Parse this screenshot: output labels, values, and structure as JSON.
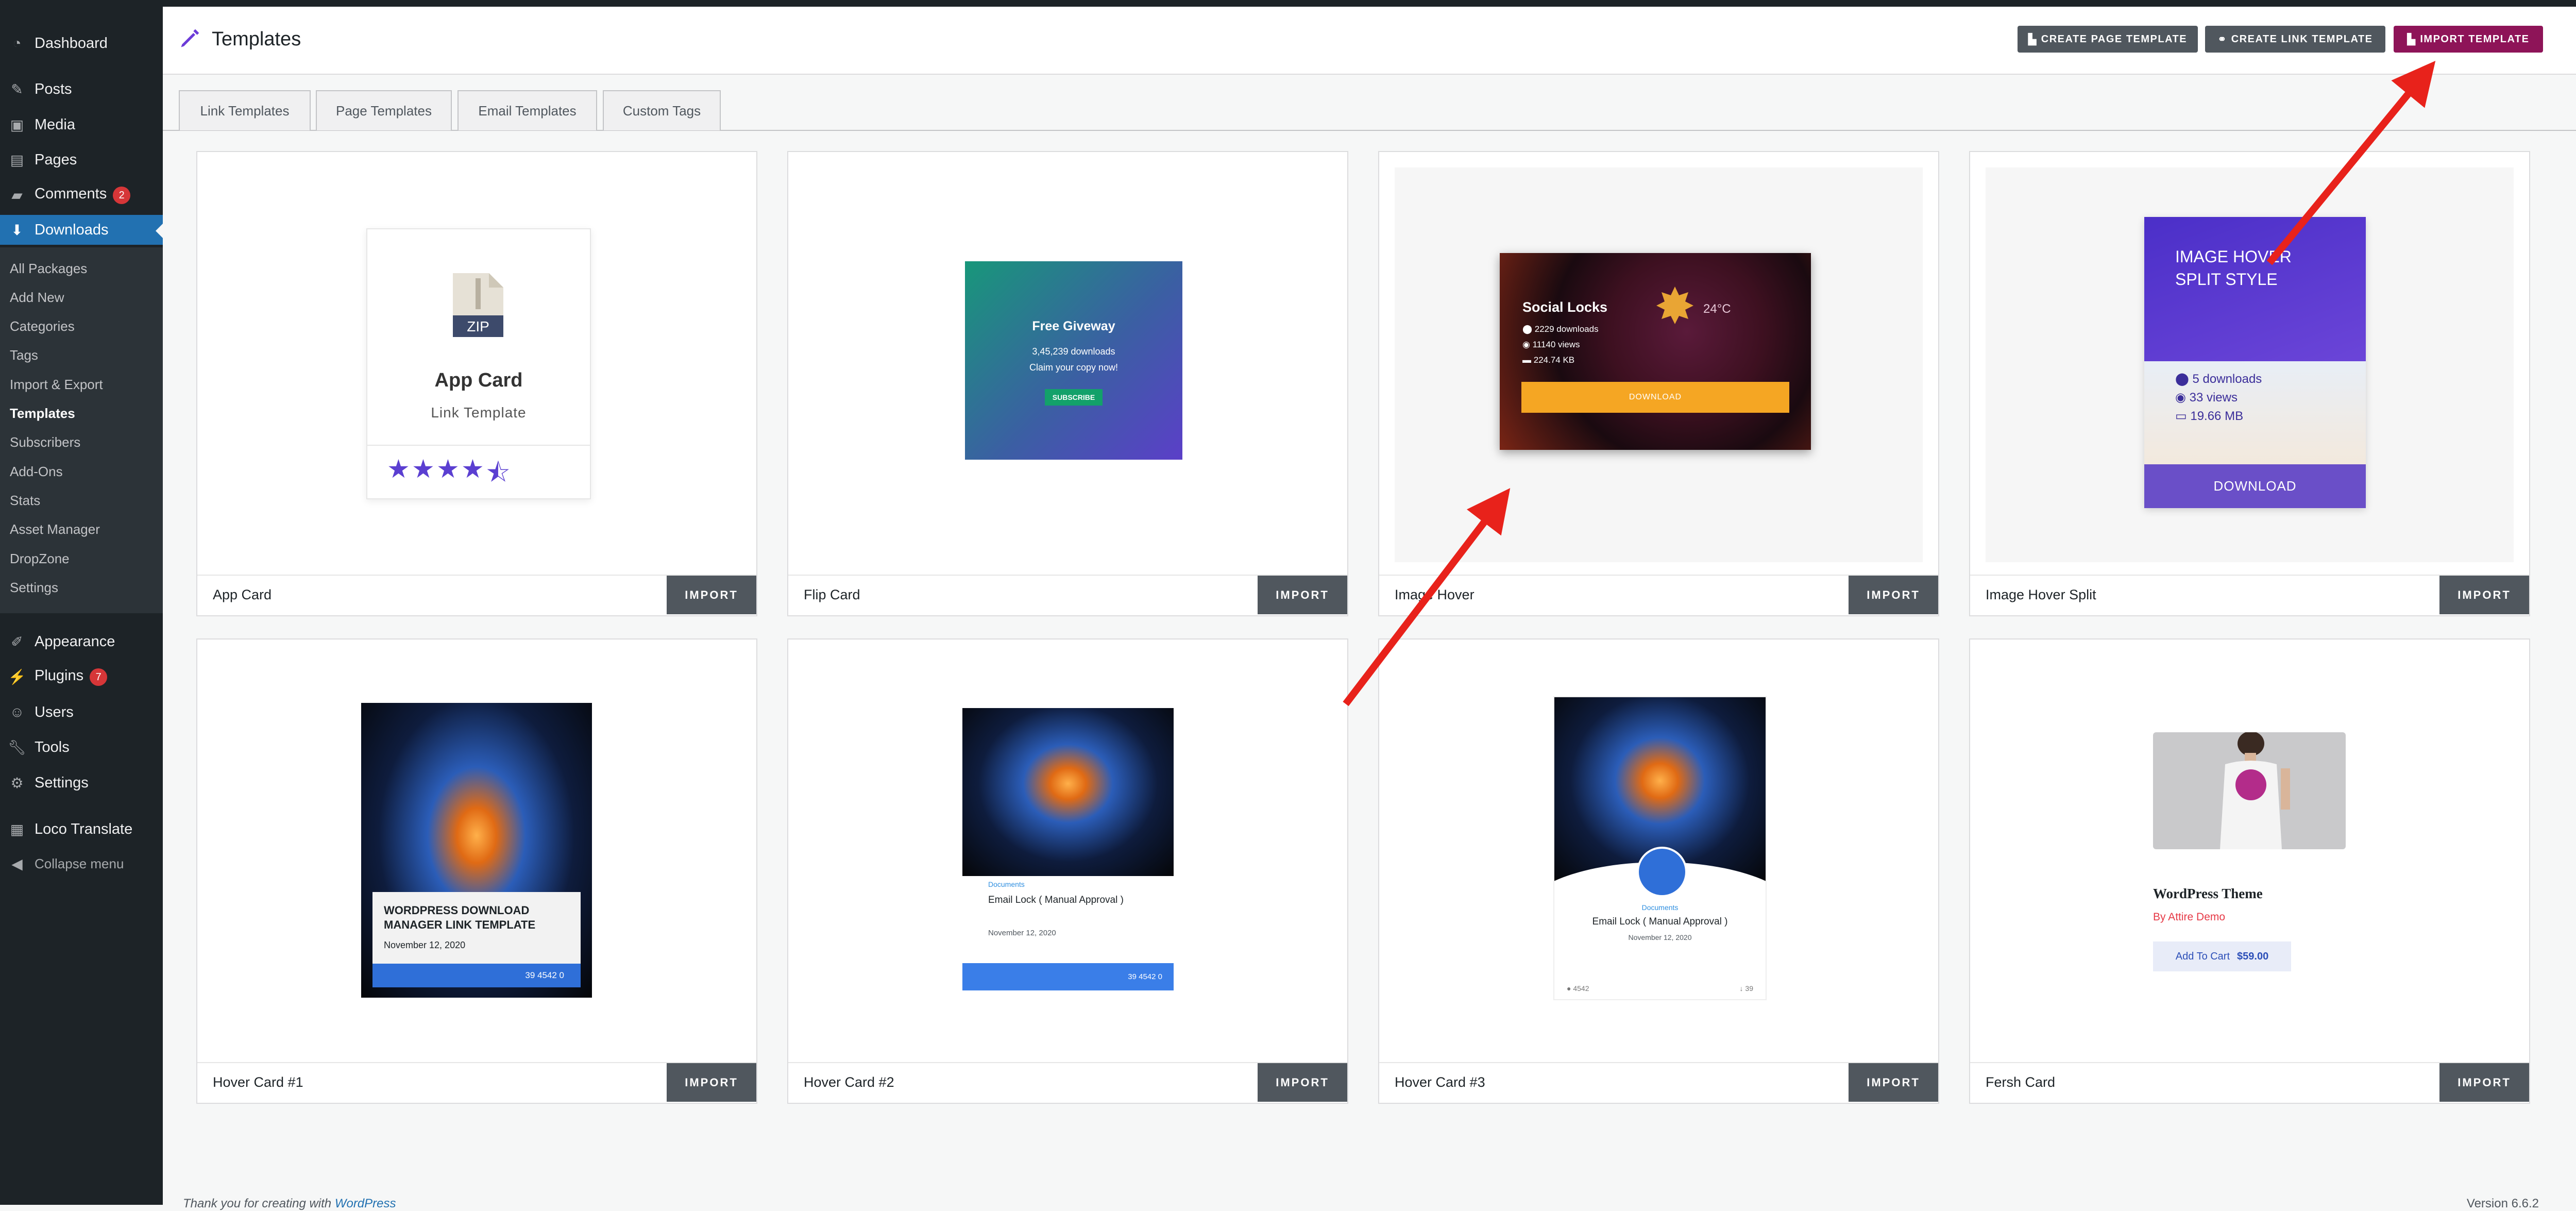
{
  "sidebar": {
    "menu": [
      {
        "label": "Dashboard",
        "icon": "dashboard-icon"
      },
      {
        "label": "Posts",
        "icon": "pin-icon"
      },
      {
        "label": "Media",
        "icon": "media-icon"
      },
      {
        "label": "Pages",
        "icon": "pages-icon"
      },
      {
        "label": "Comments",
        "icon": "comment-icon",
        "badge": "2"
      },
      {
        "label": "Downloads",
        "icon": "download-icon"
      },
      {
        "label": "Appearance",
        "icon": "brush-icon"
      },
      {
        "label": "Plugins",
        "icon": "plugin-icon",
        "badge": "7"
      },
      {
        "label": "Users",
        "icon": "user-icon"
      },
      {
        "label": "Tools",
        "icon": "wrench-icon"
      },
      {
        "label": "Settings",
        "icon": "settings-icon"
      },
      {
        "label": "Loco Translate",
        "icon": "translate-icon"
      },
      {
        "label": "Collapse menu",
        "icon": "collapse-icon"
      }
    ],
    "submenu": [
      "All Packages",
      "Add New",
      "Categories",
      "Tags",
      "Import & Export",
      "Templates",
      "Subscribers",
      "Add-Ons",
      "Stats",
      "Asset Manager",
      "DropZone",
      "Settings"
    ]
  },
  "header": {
    "title": "Templates",
    "buttons": [
      "CREATE PAGE TEMPLATE",
      "CREATE LINK TEMPLATE",
      "IMPORT TEMPLATE"
    ]
  },
  "tabs": [
    "Link Templates",
    "Page Templates",
    "Email Templates",
    "Custom Tags"
  ],
  "import_label": "IMPORT",
  "cards": [
    {
      "name": "App Card"
    },
    {
      "name": "Flip Card"
    },
    {
      "name": "Image Hover"
    },
    {
      "name": "Image Hover Split"
    },
    {
      "name": "Hover Card #1"
    },
    {
      "name": "Hover Card #2"
    },
    {
      "name": "Hover Card #3"
    },
    {
      "name": "Fersh Card"
    }
  ],
  "previews": {
    "app_card": {
      "zip": "ZIP",
      "title": "App Card",
      "subtitle": "Link Template",
      "rating": 4.5
    },
    "flip_card": {
      "title": "Free Giveway",
      "downloads": "3,45,239 downloads",
      "claim": "Claim your copy now!",
      "button": "SUBSCRIBE"
    },
    "image_hover": {
      "title": "Social Locks",
      "downloads": "2229 downloads",
      "views": "11140 views",
      "size": "224.74 KB",
      "button": "DOWNLOAD",
      "temp": "24°C"
    },
    "image_hover_split": {
      "title": "IMAGE HOVER SPLIT STYLE",
      "downloads": "5 downloads",
      "views": "33 views",
      "size": "19.66 MB",
      "button": "DOWNLOAD"
    },
    "hover_card_1": {
      "title": "WORDPRESS DOWNLOAD MANAGER LINK TEMPLATE",
      "date": "November 12, 2020",
      "stats": "39   4542   0"
    },
    "hover_card_2": {
      "category": "Documents",
      "title": "Email Lock ( Manual Approval )",
      "date": "November 12, 2020",
      "stats": "39   4542   0"
    },
    "hover_card_3": {
      "category": "Documents",
      "title": "Email Lock ( Manual Approval )",
      "date": "November 12, 2020",
      "views": "4542",
      "downloads": "39"
    },
    "fersh_card": {
      "title": "WordPress Theme",
      "by": "By Attire Demo",
      "button": "Add To Cart",
      "price": "$59.00"
    }
  },
  "footer": {
    "text": "Thank you for creating with",
    "link": "WordPress",
    "version": "Version 6.6.2"
  },
  "colors": {
    "accent": "#2271b1",
    "import_template": "#8e1458",
    "sidebar": "#1d2327",
    "arrow": "#e8221b"
  }
}
